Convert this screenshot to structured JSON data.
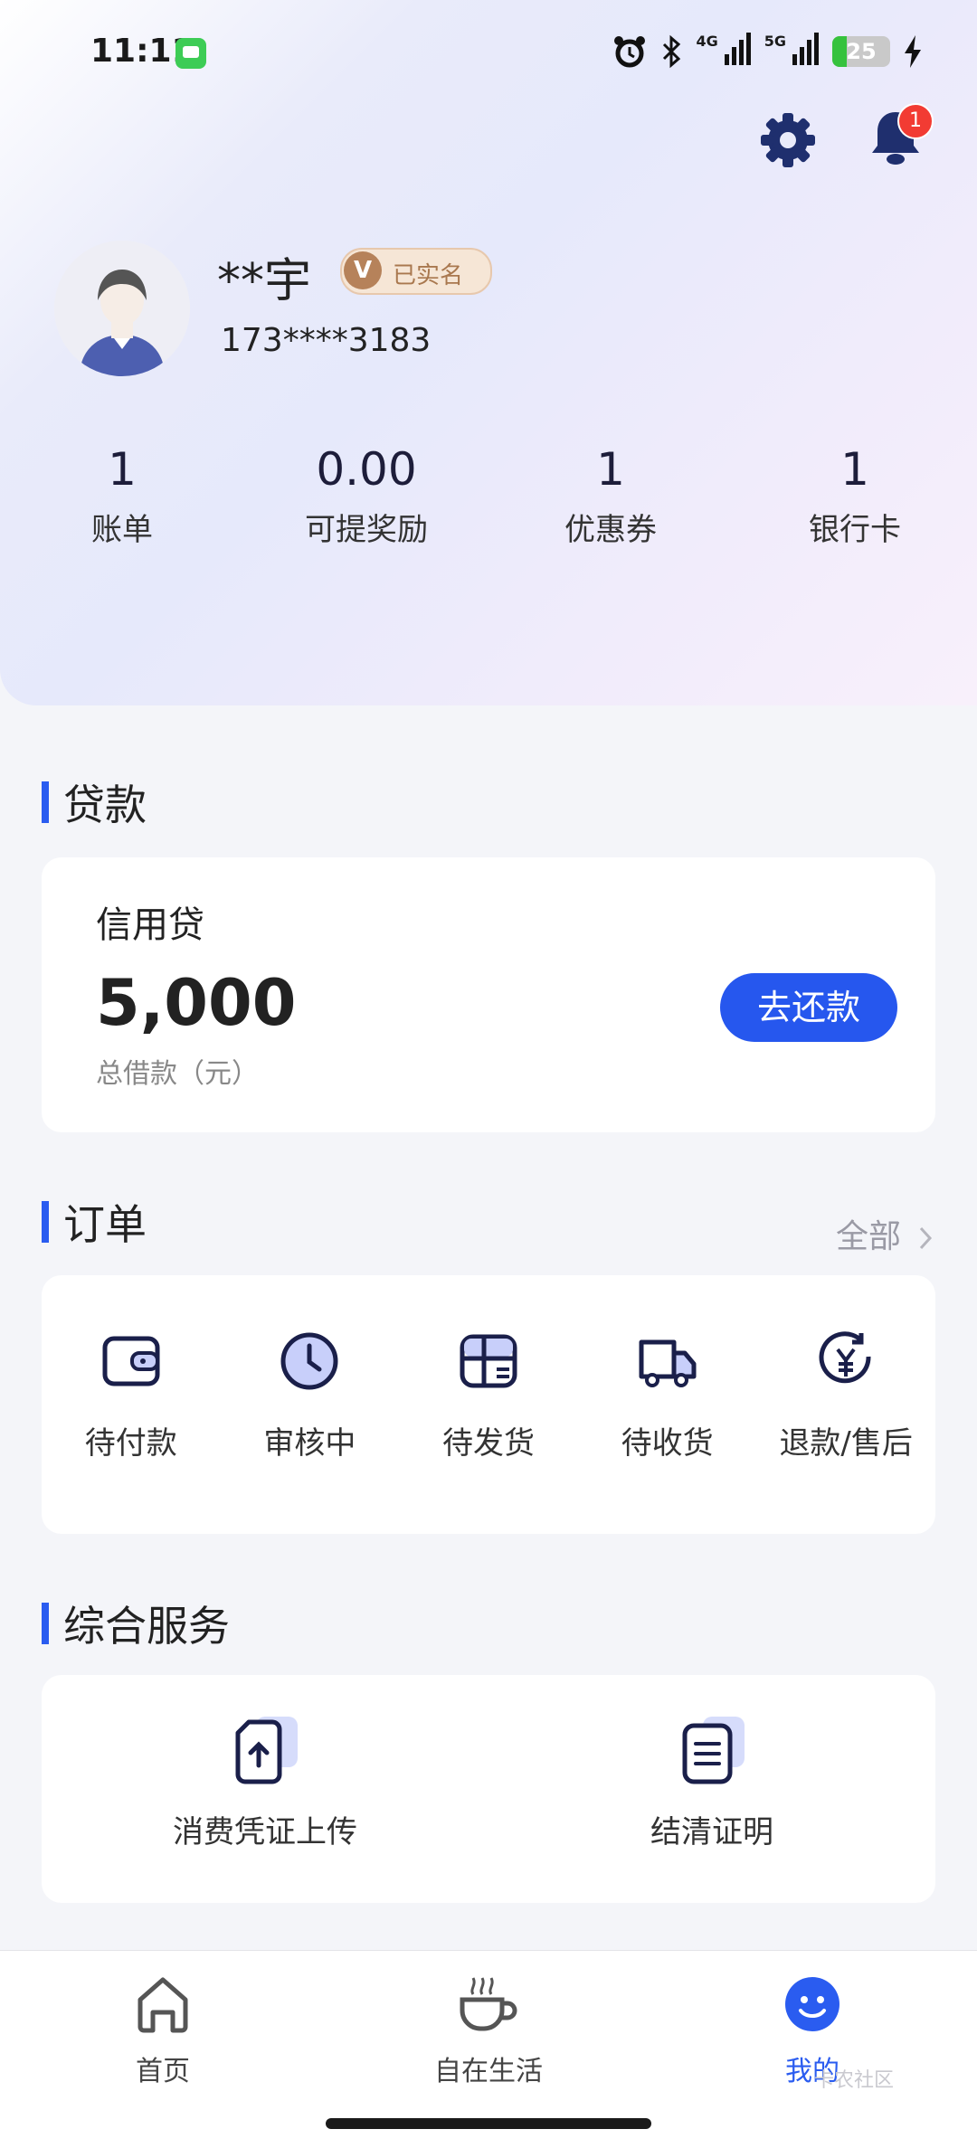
{
  "status_bar": {
    "time": "11:11",
    "battery": "25",
    "net1": "4G",
    "net2": "5G"
  },
  "header": {
    "notification_count": "1"
  },
  "profile": {
    "name": "**宇",
    "verified_label": "已实名",
    "verified_mark": "V",
    "phone": "173****3183"
  },
  "stats": [
    {
      "value": "1",
      "label": "账单"
    },
    {
      "value": "0.00",
      "label": "可提奖励"
    },
    {
      "value": "1",
      "label": "优惠券"
    },
    {
      "value": "1",
      "label": "银行卡"
    }
  ],
  "loan": {
    "section_title": "贷款",
    "product": "信用贷",
    "amount": "5,000",
    "amount_label": "总借款（元）",
    "repay_button": "去还款"
  },
  "orders": {
    "section_title": "订单",
    "all_link": "全部",
    "items": [
      {
        "label": "待付款",
        "icon": "wallet-icon"
      },
      {
        "label": "审核中",
        "icon": "clock-icon"
      },
      {
        "label": "待发货",
        "icon": "package-icon"
      },
      {
        "label": "待收货",
        "icon": "truck-icon"
      },
      {
        "label": "退款/售后",
        "icon": "refund-icon"
      }
    ]
  },
  "services": {
    "section_title": "综合服务",
    "items": [
      {
        "label": "消费凭证上传",
        "icon": "upload-document-icon"
      },
      {
        "label": "结清证明",
        "icon": "certificate-document-icon"
      }
    ]
  },
  "tabbar": {
    "items": [
      {
        "label": "首页",
        "icon": "home-icon",
        "active": false
      },
      {
        "label": "自在生活",
        "icon": "coffee-cup-icon",
        "active": false
      },
      {
        "label": "我的",
        "icon": "smile-face-icon",
        "active": true
      }
    ]
  },
  "watermark": "卡农社区",
  "colors": {
    "accent": "#2657ee",
    "badge": "#f23b33",
    "verified": "#b6825a"
  }
}
